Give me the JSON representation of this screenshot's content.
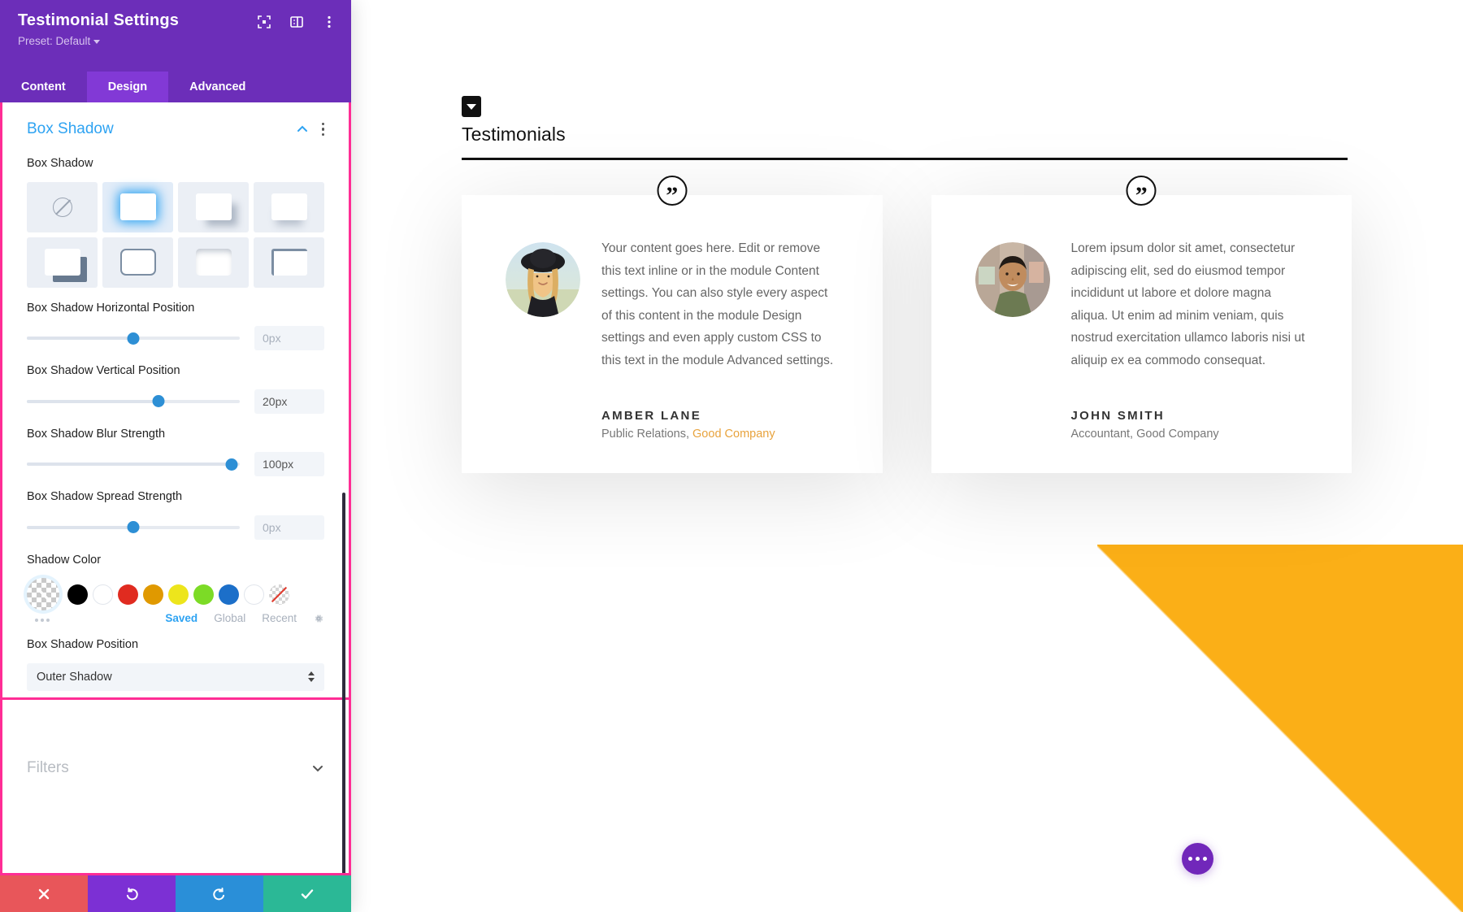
{
  "panel": {
    "title": "Testimonial Settings",
    "preset_label": "Preset: Default",
    "header_icons": [
      {
        "name": "focus-target-icon"
      },
      {
        "name": "layout-columns-icon"
      },
      {
        "name": "kebab-menu-icon"
      }
    ],
    "tabs": [
      {
        "label": "Content",
        "active": false
      },
      {
        "label": "Design",
        "active": true
      },
      {
        "label": "Advanced",
        "active": false
      }
    ],
    "box_shadow_section": {
      "title": "Box Shadow",
      "collapse_icon": "chevron-up-icon",
      "menu_icon": "kebab-menu-icon",
      "preset_field_label": "Box Shadow",
      "presets": [
        {
          "name": "shadow-preset-none",
          "selected": false
        },
        {
          "name": "shadow-preset-glow",
          "selected": true
        },
        {
          "name": "shadow-preset-diagonal-soft",
          "selected": false
        },
        {
          "name": "shadow-preset-bottom-soft",
          "selected": false
        },
        {
          "name": "shadow-preset-hard-offset",
          "selected": false
        },
        {
          "name": "shadow-preset-outline",
          "selected": false
        },
        {
          "name": "shadow-preset-inset",
          "selected": false
        },
        {
          "name": "shadow-preset-corner-border",
          "selected": false
        }
      ],
      "sliders": [
        {
          "name": "horizontal-position",
          "label": "Box Shadow Horizontal Position",
          "value": "0px",
          "is_placeholder": true,
          "knob_percent": 50
        },
        {
          "name": "vertical-position",
          "label": "Box Shadow Vertical Position",
          "value": "20px",
          "is_placeholder": false,
          "knob_percent": 62
        },
        {
          "name": "blur-strength",
          "label": "Box Shadow Blur Strength",
          "value": "100px",
          "is_placeholder": false,
          "knob_percent": 96
        },
        {
          "name": "spread-strength",
          "label": "Box Shadow Spread Strength",
          "value": "0px",
          "is_placeholder": true,
          "knob_percent": 50
        }
      ],
      "shadow_color": {
        "label": "Shadow Color",
        "selected_swatch": "transparent-eyedropper",
        "swatches": [
          "#000000",
          "#FFFFFF",
          "#E02B20",
          "#E09900",
          "#EDE51C",
          "#7CDB26",
          "#1C6FC9",
          "#FFFFFF"
        ],
        "more_icon": "ellipsis-icon",
        "clear_swatch": "no-color-icon",
        "source_tabs": [
          {
            "label": "Saved",
            "active": true
          },
          {
            "label": "Global",
            "active": false
          },
          {
            "label": "Recent",
            "active": false
          }
        ],
        "settings_icon": "gear-icon"
      },
      "position": {
        "label": "Box Shadow Position",
        "value": "Outer Shadow"
      }
    },
    "filters_section": {
      "title": "Filters",
      "expand_icon": "chevron-down-icon"
    },
    "actions": [
      {
        "name": "cancel-button",
        "icon": "close-icon",
        "color": "#E8565A"
      },
      {
        "name": "undo-button",
        "icon": "undo-icon",
        "color": "#7C30D4"
      },
      {
        "name": "redo-button",
        "icon": "redo-icon",
        "color": "#2A8FD8"
      },
      {
        "name": "save-button",
        "icon": "check-icon",
        "color": "#2BB896"
      }
    ]
  },
  "canvas": {
    "section_handle_icon": "caret-down-icon",
    "page_title": "Testimonials",
    "accent_wedge_color": "#FBAF17",
    "fab": {
      "name": "page-settings-fab",
      "icon": "ellipsis-icon",
      "color": "#7127BA"
    },
    "testimonials": [
      {
        "quote_icon": "quote-mark-icon",
        "avatar_name": "avatar-amber-lane",
        "text": "Your content goes here. Edit or remove this text inline or in the module Content settings. You can also style every aspect of this content in the module Design settings and even apply custom CSS to this text in the module Advanced settings.",
        "author": "AMBER LANE",
        "role": "Public Relations, ",
        "company": "Good Company"
      },
      {
        "quote_icon": "quote-mark-icon",
        "avatar_name": "avatar-john-smith",
        "text": "Lorem ipsum dolor sit amet, consectetur adipiscing elit, sed do eiusmod tempor incididunt ut labore et dolore magna aliqua. Ut enim ad minim veniam, quis nostrud exercitation ullamco laboris nisi ut aliquip ex ea commodo consequat.",
        "author": "JOHN SMITH",
        "role": "Accountant, Good Company",
        "company": ""
      }
    ]
  }
}
